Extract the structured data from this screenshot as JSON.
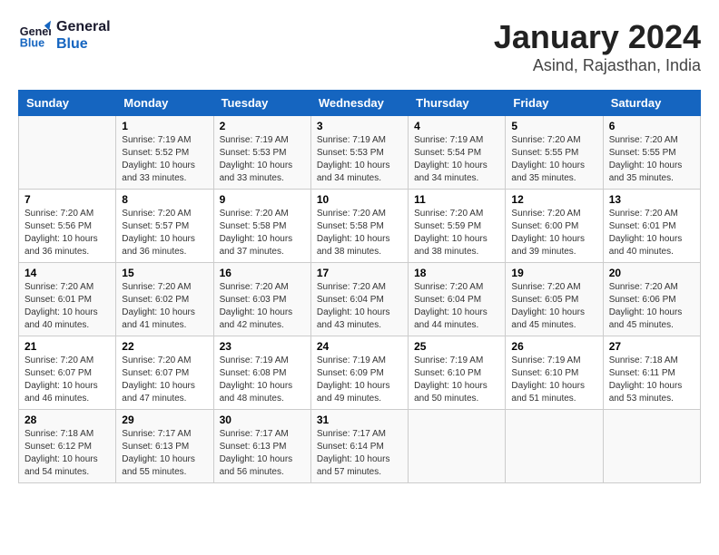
{
  "header": {
    "logo_line1": "General",
    "logo_line2": "Blue",
    "month": "January 2024",
    "location": "Asind, Rajasthan, India"
  },
  "days_of_week": [
    "Sunday",
    "Monday",
    "Tuesday",
    "Wednesday",
    "Thursday",
    "Friday",
    "Saturday"
  ],
  "weeks": [
    [
      {
        "day": "",
        "info": ""
      },
      {
        "day": "1",
        "info": "Sunrise: 7:19 AM\nSunset: 5:52 PM\nDaylight: 10 hours\nand 33 minutes."
      },
      {
        "day": "2",
        "info": "Sunrise: 7:19 AM\nSunset: 5:53 PM\nDaylight: 10 hours\nand 33 minutes."
      },
      {
        "day": "3",
        "info": "Sunrise: 7:19 AM\nSunset: 5:53 PM\nDaylight: 10 hours\nand 34 minutes."
      },
      {
        "day": "4",
        "info": "Sunrise: 7:19 AM\nSunset: 5:54 PM\nDaylight: 10 hours\nand 34 minutes."
      },
      {
        "day": "5",
        "info": "Sunrise: 7:20 AM\nSunset: 5:55 PM\nDaylight: 10 hours\nand 35 minutes."
      },
      {
        "day": "6",
        "info": "Sunrise: 7:20 AM\nSunset: 5:55 PM\nDaylight: 10 hours\nand 35 minutes."
      }
    ],
    [
      {
        "day": "7",
        "info": "Sunrise: 7:20 AM\nSunset: 5:56 PM\nDaylight: 10 hours\nand 36 minutes."
      },
      {
        "day": "8",
        "info": "Sunrise: 7:20 AM\nSunset: 5:57 PM\nDaylight: 10 hours\nand 36 minutes."
      },
      {
        "day": "9",
        "info": "Sunrise: 7:20 AM\nSunset: 5:58 PM\nDaylight: 10 hours\nand 37 minutes."
      },
      {
        "day": "10",
        "info": "Sunrise: 7:20 AM\nSunset: 5:58 PM\nDaylight: 10 hours\nand 38 minutes."
      },
      {
        "day": "11",
        "info": "Sunrise: 7:20 AM\nSunset: 5:59 PM\nDaylight: 10 hours\nand 38 minutes."
      },
      {
        "day": "12",
        "info": "Sunrise: 7:20 AM\nSunset: 6:00 PM\nDaylight: 10 hours\nand 39 minutes."
      },
      {
        "day": "13",
        "info": "Sunrise: 7:20 AM\nSunset: 6:01 PM\nDaylight: 10 hours\nand 40 minutes."
      }
    ],
    [
      {
        "day": "14",
        "info": "Sunrise: 7:20 AM\nSunset: 6:01 PM\nDaylight: 10 hours\nand 40 minutes."
      },
      {
        "day": "15",
        "info": "Sunrise: 7:20 AM\nSunset: 6:02 PM\nDaylight: 10 hours\nand 41 minutes."
      },
      {
        "day": "16",
        "info": "Sunrise: 7:20 AM\nSunset: 6:03 PM\nDaylight: 10 hours\nand 42 minutes."
      },
      {
        "day": "17",
        "info": "Sunrise: 7:20 AM\nSunset: 6:04 PM\nDaylight: 10 hours\nand 43 minutes."
      },
      {
        "day": "18",
        "info": "Sunrise: 7:20 AM\nSunset: 6:04 PM\nDaylight: 10 hours\nand 44 minutes."
      },
      {
        "day": "19",
        "info": "Sunrise: 7:20 AM\nSunset: 6:05 PM\nDaylight: 10 hours\nand 45 minutes."
      },
      {
        "day": "20",
        "info": "Sunrise: 7:20 AM\nSunset: 6:06 PM\nDaylight: 10 hours\nand 45 minutes."
      }
    ],
    [
      {
        "day": "21",
        "info": "Sunrise: 7:20 AM\nSunset: 6:07 PM\nDaylight: 10 hours\nand 46 minutes."
      },
      {
        "day": "22",
        "info": "Sunrise: 7:20 AM\nSunset: 6:07 PM\nDaylight: 10 hours\nand 47 minutes."
      },
      {
        "day": "23",
        "info": "Sunrise: 7:19 AM\nSunset: 6:08 PM\nDaylight: 10 hours\nand 48 minutes."
      },
      {
        "day": "24",
        "info": "Sunrise: 7:19 AM\nSunset: 6:09 PM\nDaylight: 10 hours\nand 49 minutes."
      },
      {
        "day": "25",
        "info": "Sunrise: 7:19 AM\nSunset: 6:10 PM\nDaylight: 10 hours\nand 50 minutes."
      },
      {
        "day": "26",
        "info": "Sunrise: 7:19 AM\nSunset: 6:10 PM\nDaylight: 10 hours\nand 51 minutes."
      },
      {
        "day": "27",
        "info": "Sunrise: 7:18 AM\nSunset: 6:11 PM\nDaylight: 10 hours\nand 53 minutes."
      }
    ],
    [
      {
        "day": "28",
        "info": "Sunrise: 7:18 AM\nSunset: 6:12 PM\nDaylight: 10 hours\nand 54 minutes."
      },
      {
        "day": "29",
        "info": "Sunrise: 7:17 AM\nSunset: 6:13 PM\nDaylight: 10 hours\nand 55 minutes."
      },
      {
        "day": "30",
        "info": "Sunrise: 7:17 AM\nSunset: 6:13 PM\nDaylight: 10 hours\nand 56 minutes."
      },
      {
        "day": "31",
        "info": "Sunrise: 7:17 AM\nSunset: 6:14 PM\nDaylight: 10 hours\nand 57 minutes."
      },
      {
        "day": "",
        "info": ""
      },
      {
        "day": "",
        "info": ""
      },
      {
        "day": "",
        "info": ""
      }
    ]
  ]
}
